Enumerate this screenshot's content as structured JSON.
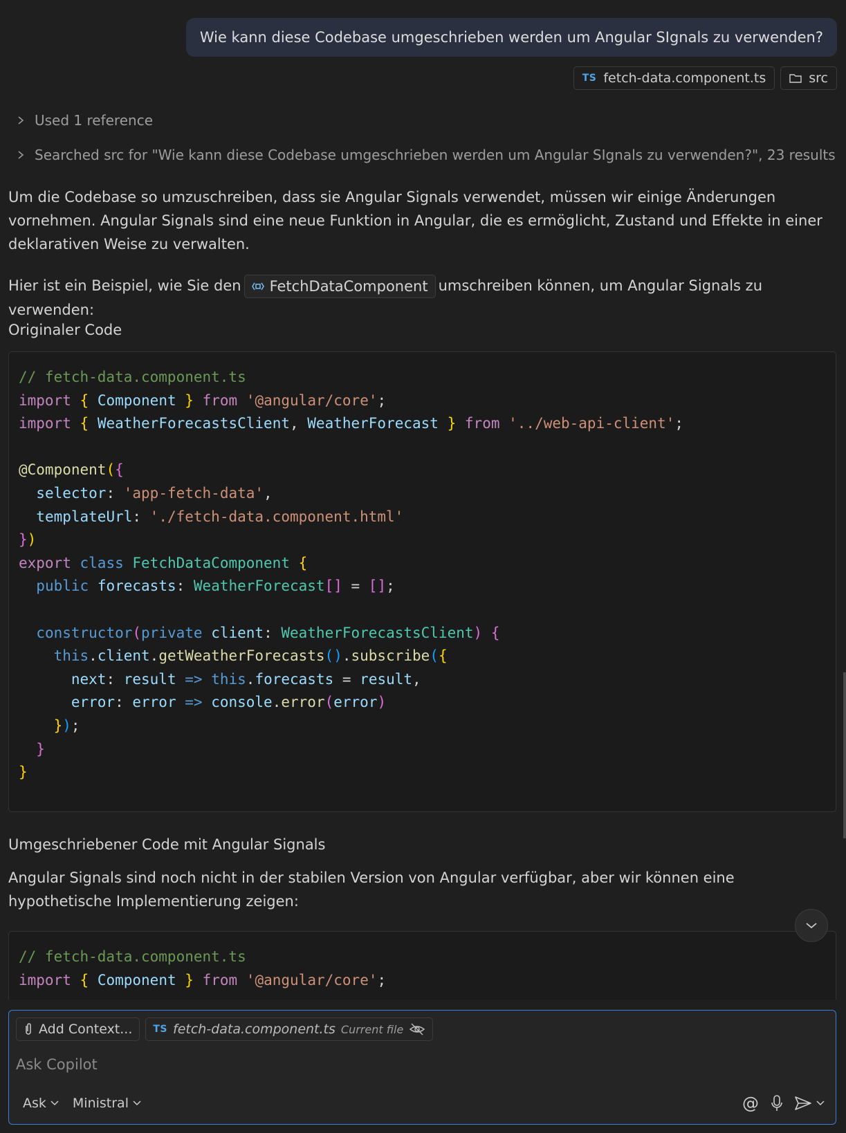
{
  "user_message": {
    "text": "Wie kann diese Codebase umgeschrieben werden um Angular SIgnals zu verwenden?",
    "attachments": [
      {
        "badge": "TS",
        "label": "fetch-data.component.ts",
        "icon": "typescript-file-icon"
      },
      {
        "label": "src",
        "icon": "folder-icon"
      }
    ]
  },
  "references": {
    "used": "Used 1 reference",
    "searched": "Searched src for \"Wie kann diese Codebase umgeschrieben werden um Angular SIgnals zu verwenden?\", 23 results"
  },
  "response": {
    "intro_1": "Um die Codebase so umzuschreiben, dass sie Angular Signals verwendet, müssen wir einige Änderungen vornehmen. Angular Signals sind eine neue Funktion in Angular, die es ermöglicht, Zustand und Effekte in einer deklarativen Weise zu verwalten.",
    "intro_2_before": "Hier ist ein Beispiel, wie Sie den",
    "symbol_ref": "FetchDataComponent",
    "intro_2_after": "umschreiben können, um Angular Signals zu verwenden:",
    "heading_original": "Originaler Code",
    "heading_rewritten": "Umgeschriebener Code mit Angular Signals",
    "note": "Angular Signals sind noch nicht in der stabilen Version von Angular verfügbar, aber wir können eine hypothetische Implementierung zeigen:"
  },
  "code_original": [
    [
      [
        "c-com",
        "// fetch-data.component.ts"
      ]
    ],
    [
      [
        "c-kw",
        "import"
      ],
      [
        "",
        " "
      ],
      [
        "c-b1",
        "{"
      ],
      [
        "",
        " "
      ],
      [
        "c-var",
        "Component"
      ],
      [
        "",
        " "
      ],
      [
        "c-b1",
        "}"
      ],
      [
        "",
        " "
      ],
      [
        "c-kw",
        "from"
      ],
      [
        "",
        " "
      ],
      [
        "c-str",
        "'@angular/core'"
      ],
      [
        "",
        ";"
      ]
    ],
    [
      [
        "c-kw",
        "import"
      ],
      [
        "",
        " "
      ],
      [
        "c-b1",
        "{"
      ],
      [
        "",
        " "
      ],
      [
        "c-var",
        "WeatherForecastsClient"
      ],
      [
        "",
        ", "
      ],
      [
        "c-var",
        "WeatherForecast"
      ],
      [
        "",
        " "
      ],
      [
        "c-b1",
        "}"
      ],
      [
        "",
        " "
      ],
      [
        "c-kw",
        "from"
      ],
      [
        "",
        " "
      ],
      [
        "c-str",
        "'../web-api-client'"
      ],
      [
        "",
        ";"
      ]
    ],
    [],
    [
      [
        "c-fn",
        "@Component"
      ],
      [
        "c-b1",
        "("
      ],
      [
        "c-b2",
        "{"
      ]
    ],
    [
      [
        "",
        "  "
      ],
      [
        "c-var",
        "selector"
      ],
      [
        "",
        ": "
      ],
      [
        "c-str",
        "'app-fetch-data'"
      ],
      [
        "",
        ","
      ]
    ],
    [
      [
        "",
        "  "
      ],
      [
        "c-var",
        "templateUrl"
      ],
      [
        "",
        ": "
      ],
      [
        "c-str",
        "'./fetch-data.component.html'"
      ]
    ],
    [
      [
        "c-b2",
        "}"
      ],
      [
        "c-b1",
        ")"
      ]
    ],
    [
      [
        "c-kw",
        "export"
      ],
      [
        "",
        " "
      ],
      [
        "c-kw2",
        "class"
      ],
      [
        "",
        " "
      ],
      [
        "c-type",
        "FetchDataComponent"
      ],
      [
        "",
        " "
      ],
      [
        "c-b1",
        "{"
      ]
    ],
    [
      [
        "",
        "  "
      ],
      [
        "c-kw2",
        "public"
      ],
      [
        "",
        " "
      ],
      [
        "c-var",
        "forecasts"
      ],
      [
        "",
        ": "
      ],
      [
        "c-type",
        "WeatherForecast"
      ],
      [
        "c-b2",
        "[]"
      ],
      [
        "",
        " = "
      ],
      [
        "c-b2",
        "[]"
      ],
      [
        "",
        ";"
      ]
    ],
    [],
    [
      [
        "",
        "  "
      ],
      [
        "c-kw2",
        "constructor"
      ],
      [
        "c-b2",
        "("
      ],
      [
        "c-kw2",
        "private"
      ],
      [
        "",
        " "
      ],
      [
        "c-var",
        "client"
      ],
      [
        "",
        ": "
      ],
      [
        "c-type",
        "WeatherForecastsClient"
      ],
      [
        "c-b2",
        ")"
      ],
      [
        "",
        " "
      ],
      [
        "c-b2",
        "{"
      ]
    ],
    [
      [
        "",
        "    "
      ],
      [
        "c-kw2",
        "this"
      ],
      [
        "",
        "."
      ],
      [
        "c-var",
        "client"
      ],
      [
        "",
        "."
      ],
      [
        "c-fn",
        "getWeatherForecasts"
      ],
      [
        "c-b3",
        "()"
      ],
      [
        "",
        "."
      ],
      [
        "c-fn",
        "subscribe"
      ],
      [
        "c-b3",
        "("
      ],
      [
        "c-b1",
        "{"
      ]
    ],
    [
      [
        "",
        "      "
      ],
      [
        "c-var",
        "next"
      ],
      [
        "",
        ": "
      ],
      [
        "c-var",
        "result"
      ],
      [
        "",
        " "
      ],
      [
        "c-kw2",
        "=>"
      ],
      [
        "",
        " "
      ],
      [
        "c-kw2",
        "this"
      ],
      [
        "",
        "."
      ],
      [
        "c-var",
        "forecasts"
      ],
      [
        "",
        " = "
      ],
      [
        "c-var",
        "result"
      ],
      [
        "",
        ","
      ]
    ],
    [
      [
        "",
        "      "
      ],
      [
        "c-var",
        "error"
      ],
      [
        "",
        ": "
      ],
      [
        "c-var",
        "error"
      ],
      [
        "",
        " "
      ],
      [
        "c-kw2",
        "=>"
      ],
      [
        "",
        " "
      ],
      [
        "c-var",
        "console"
      ],
      [
        "",
        "."
      ],
      [
        "c-fn",
        "error"
      ],
      [
        "c-b2",
        "("
      ],
      [
        "c-var",
        "error"
      ],
      [
        "c-b2",
        ")"
      ]
    ],
    [
      [
        "",
        "    "
      ],
      [
        "c-b1",
        "}"
      ],
      [
        "c-b3",
        ")"
      ],
      [
        "",
        ";"
      ]
    ],
    [
      [
        "",
        "  "
      ],
      [
        "c-b2",
        "}"
      ]
    ],
    [
      [
        "c-b1",
        "}"
      ]
    ]
  ],
  "code_rewritten": [
    [
      [
        "c-com",
        "// fetch-data.component.ts"
      ]
    ],
    [
      [
        "c-kw",
        "import"
      ],
      [
        "",
        " "
      ],
      [
        "c-b1",
        "{"
      ],
      [
        "",
        " "
      ],
      [
        "c-var",
        "Component"
      ],
      [
        "",
        " "
      ],
      [
        "c-b1",
        "}"
      ],
      [
        "",
        " "
      ],
      [
        "c-kw",
        "from"
      ],
      [
        "",
        " "
      ],
      [
        "c-str",
        "'@angular/core'"
      ],
      [
        "",
        ";"
      ]
    ]
  ],
  "input": {
    "add_context": "Add Context...",
    "current_file_badge": "TS",
    "current_file": "fetch-data.component.ts",
    "current_file_label": "Current file",
    "placeholder": "Ask Copilot",
    "mode": "Ask",
    "model": "Ministral"
  },
  "colors": {
    "accent": "#3b7dd8",
    "user_bubble": "#2b3040",
    "background": "#1f1f1f"
  }
}
